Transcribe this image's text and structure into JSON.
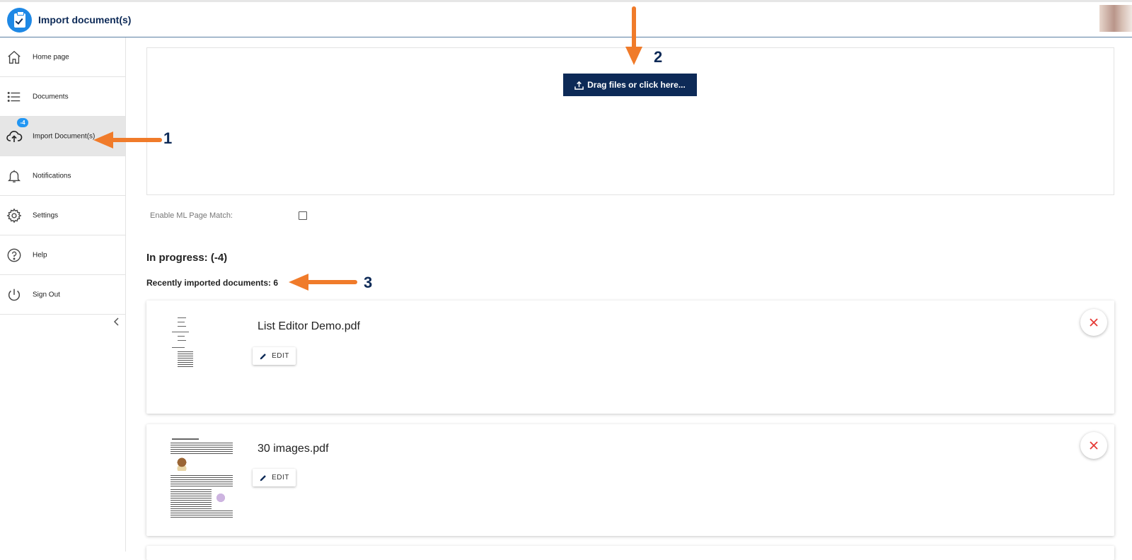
{
  "header": {
    "title": "Import document(s)"
  },
  "sidebar": {
    "items": [
      {
        "label": "Home page",
        "icon": "home-icon"
      },
      {
        "label": "Documents",
        "icon": "list-icon"
      },
      {
        "label": "Import Document(s)",
        "icon": "cloud-upload-icon",
        "badge": "-4",
        "active": true
      },
      {
        "label": "Notifications",
        "icon": "bell-icon"
      },
      {
        "label": "Settings",
        "icon": "gear-icon"
      },
      {
        "label": "Help",
        "icon": "help-icon"
      },
      {
        "label": "Sign Out",
        "icon": "power-icon"
      }
    ]
  },
  "upload": {
    "button_label": "Drag files or click here..."
  },
  "options": {
    "ml_page_match_label": "Enable ML Page Match:",
    "ml_page_match_checked": false
  },
  "status": {
    "in_progress": "In progress: (-4)",
    "recent": "Recently imported documents: 6"
  },
  "documents": [
    {
      "name": "List Editor Demo.pdf",
      "edit_label": "EDIT"
    },
    {
      "name": "30 images.pdf",
      "edit_label": "EDIT"
    }
  ],
  "annotations": {
    "one": "1",
    "two": "2",
    "three": "3"
  },
  "colors": {
    "primary": "#0d2a57",
    "accent": "#1e88e5",
    "annotation_arrow": "#f07b2a",
    "delete": "#e53935"
  }
}
